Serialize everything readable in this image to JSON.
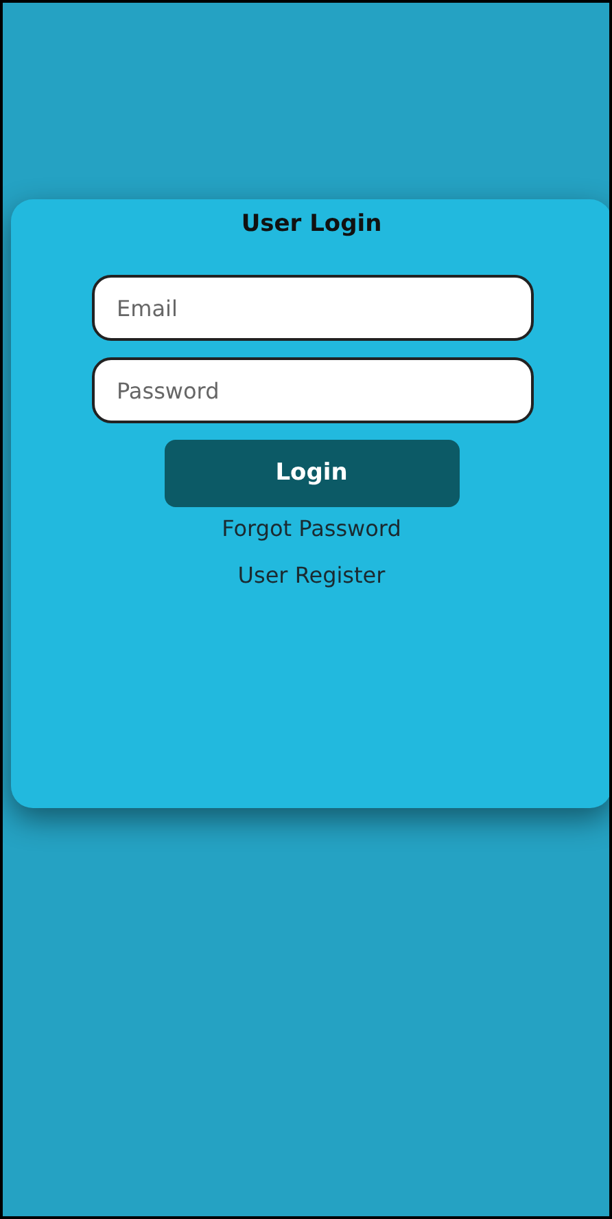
{
  "title": "User Login",
  "fields": [
    {
      "placeholder": "Email"
    },
    {
      "placeholder": "Password"
    }
  ],
  "login_button": "Login",
  "links": [
    "Forgot Password",
    "User Register"
  ]
}
